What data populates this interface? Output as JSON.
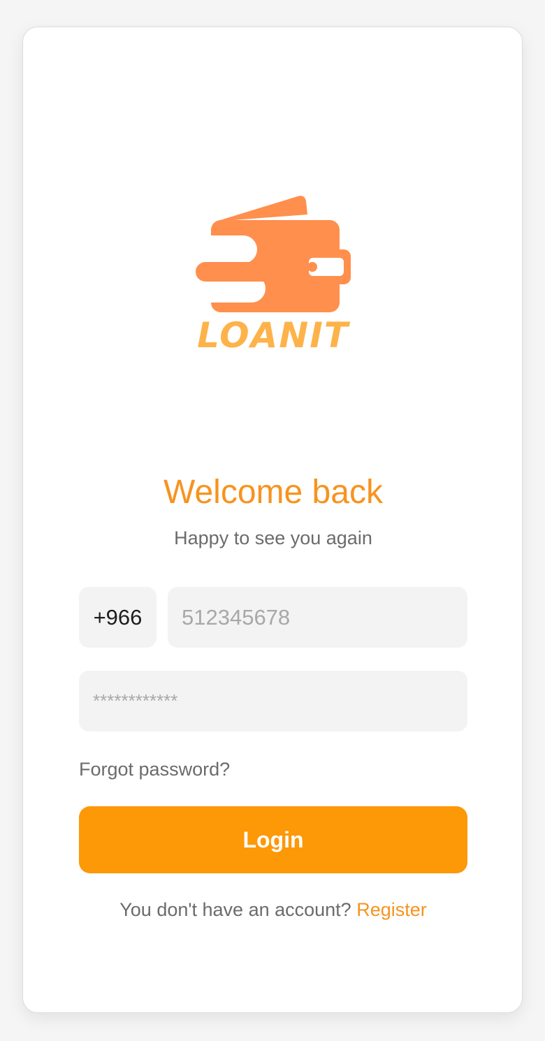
{
  "brand": {
    "logo_icon": "wallet-icon",
    "logo_text": "LOANIT",
    "colors": {
      "logo_orange": "#ff8f4c",
      "logo_text": "#fdb34a"
    }
  },
  "header": {
    "title": "Welcome back",
    "subtitle": "Happy to see you again"
  },
  "form": {
    "country_code": "+966",
    "phone_placeholder": "512345678",
    "password_placeholder": "************",
    "forgot_label": "Forgot password?",
    "login_label": "Login"
  },
  "footer": {
    "prompt": "You don't have an account?",
    "register_label": "Register"
  },
  "colors": {
    "accent": "#f7931e",
    "button": "#fd9807",
    "field_bg": "#f3f3f3",
    "muted_text": "#6b6b6b"
  }
}
